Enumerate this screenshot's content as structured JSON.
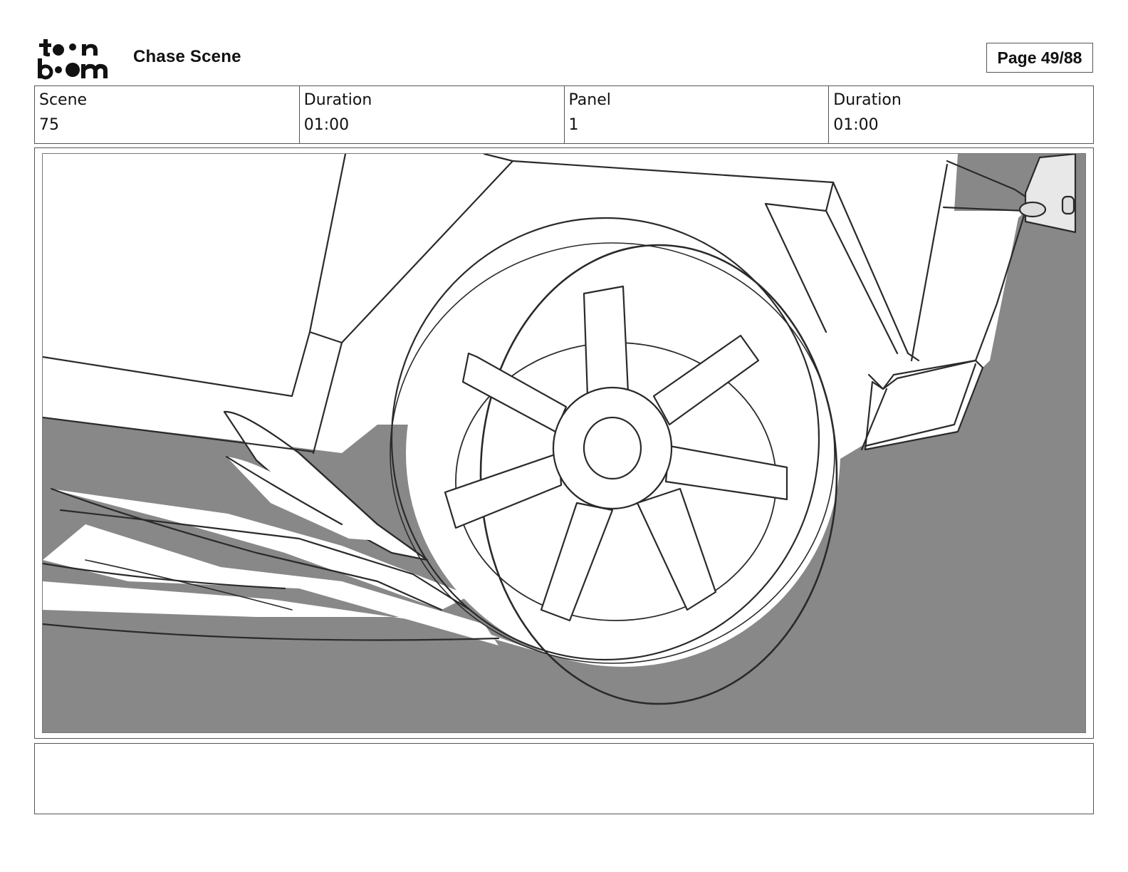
{
  "header": {
    "logo_name": "toon-boom-logo",
    "logo_text": "toon boom",
    "title": "Chase Scene",
    "page_indicator": "Page 49/88"
  },
  "info": {
    "scene_label": "Scene",
    "scene_value": "75",
    "scene_duration_label": "Duration",
    "scene_duration_value": "01:00",
    "panel_label": "Panel",
    "panel_value": "1",
    "panel_duration_label": "Duration",
    "panel_duration_value": "01:00"
  },
  "panel": {
    "content": "sketch-car-wheel-skidding"
  },
  "notes": {
    "text": ""
  },
  "colors": {
    "ground_gray": "#888888",
    "line": "#2a2a2a",
    "paper": "#ffffff"
  }
}
